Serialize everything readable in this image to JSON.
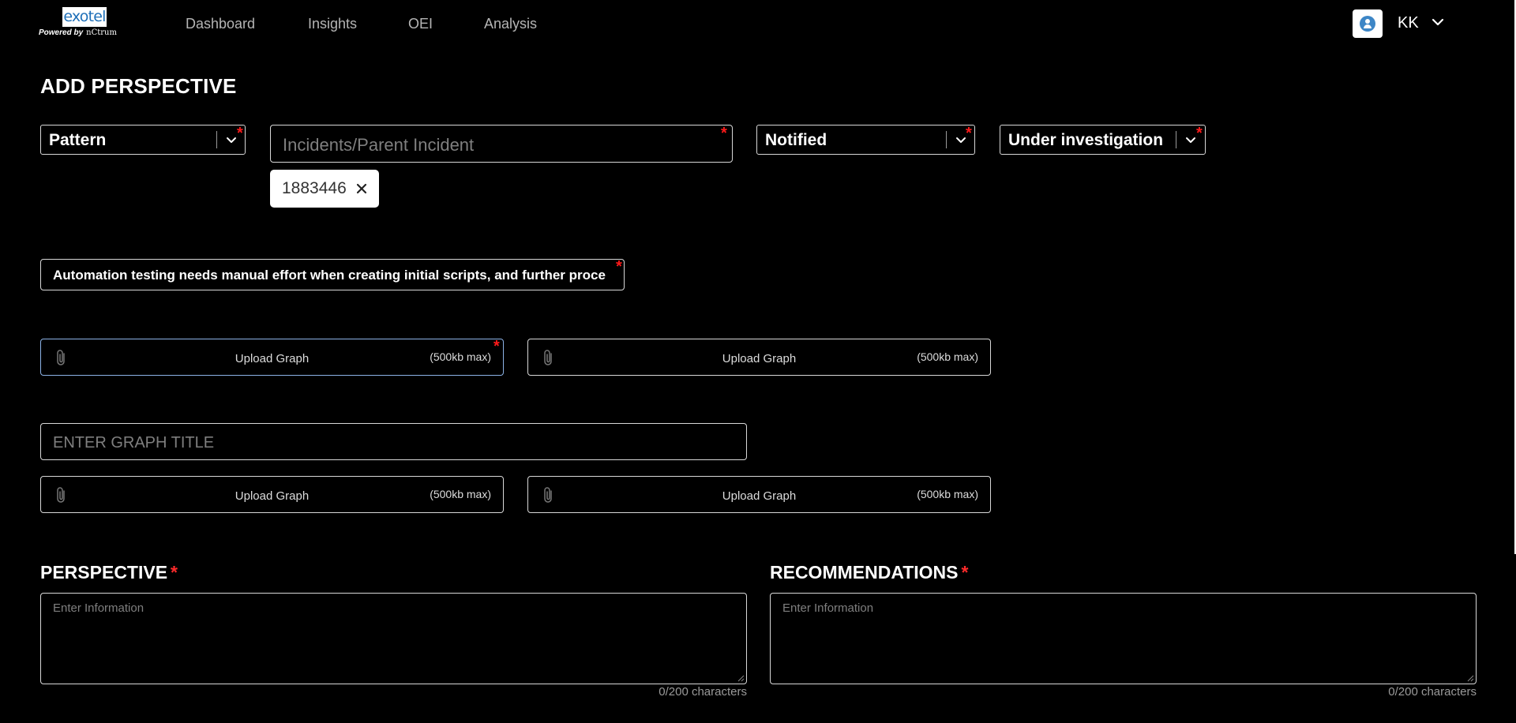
{
  "brand": {
    "logo_text": "exotel",
    "powered_by": "Powered by",
    "partner": "nCtrum"
  },
  "nav": {
    "items": [
      {
        "label": "Dashboard"
      },
      {
        "label": "Insights"
      },
      {
        "label": "OEI"
      },
      {
        "label": "Analysis"
      }
    ]
  },
  "user": {
    "initials": "KK",
    "avatar_icon": "user-avatar-icon",
    "menu_icon": "chevron-down-icon"
  },
  "page": {
    "title": "ADD PERSPECTIVE"
  },
  "form": {
    "required_mark": "*",
    "type_select": {
      "value": "Pattern"
    },
    "incident_input": {
      "placeholder": "Incidents/Parent Incident"
    },
    "incident_chips": [
      {
        "label": "1883446"
      }
    ],
    "notify_select": {
      "value": "Notified"
    },
    "status_select": {
      "value": "Under investigation"
    },
    "problem_statement": "Automation testing needs manual effort when creating initial scripts, and further proce",
    "uploads_row1": [
      {
        "label": "Upload Graph",
        "hint": "(500kb max)",
        "required": true
      },
      {
        "label": "Upload Graph",
        "hint": "(500kb max)",
        "required": false
      }
    ],
    "graph_title": {
      "placeholder": "ENTER GRAPH TITLE"
    },
    "uploads_row2": [
      {
        "label": "Upload Graph",
        "hint": "(500kb max)"
      },
      {
        "label": "Upload Graph",
        "hint": "(500kb max)"
      }
    ],
    "perspective": {
      "label": "PERSPECTIVE",
      "placeholder": "Enter Information",
      "counter": "0/200 characters"
    },
    "recommendations": {
      "label": "RECOMMENDATIONS",
      "placeholder": "Enter Information",
      "counter": "0/200 characters"
    }
  },
  "colors": {
    "background": "#000000",
    "border": "#d8d8d8",
    "required": "#ff1a1a",
    "placeholder": "#7f7f7f",
    "focus_border": "#8cb2e6",
    "brand_blue": "#1e6fb8"
  }
}
